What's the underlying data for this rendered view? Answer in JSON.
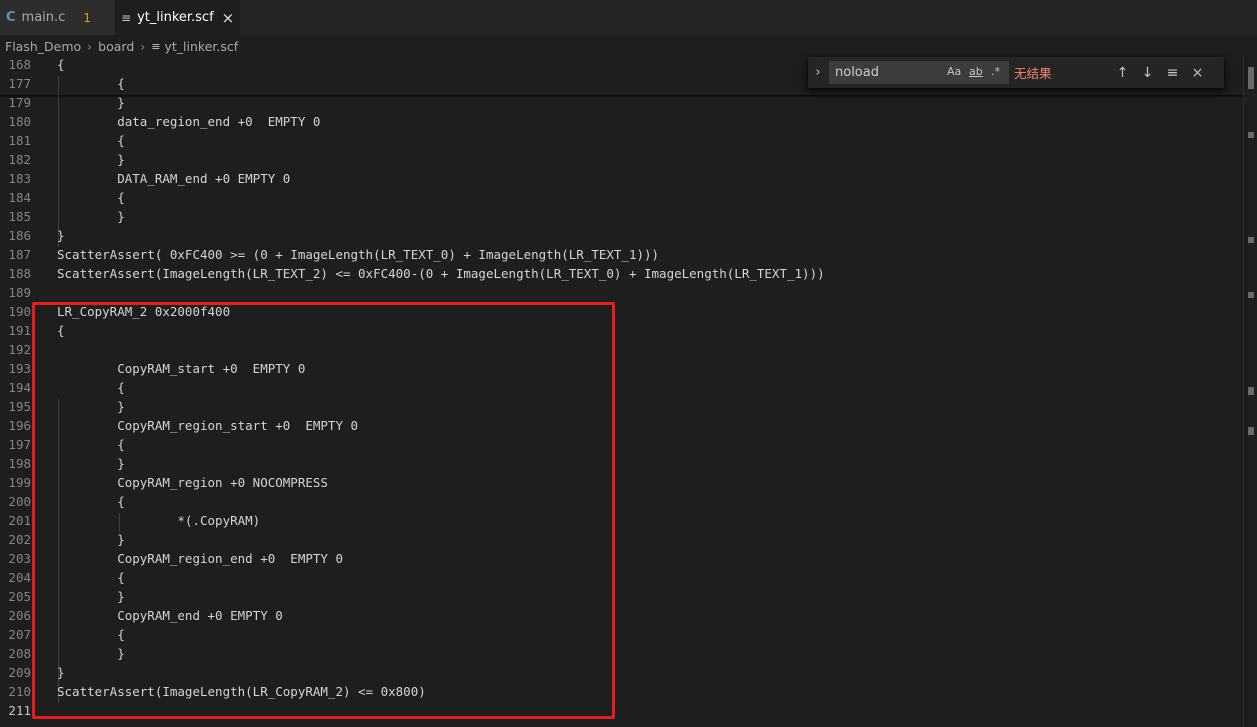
{
  "tabs": [
    {
      "icon": "C",
      "label": "main.c",
      "badge": "1",
      "active": false
    },
    {
      "icon": "≡",
      "label": "yt_linker.scf",
      "close": "×",
      "active": true
    }
  ],
  "breadcrumb": {
    "items": [
      "Flash_Demo",
      "board",
      "yt_linker.scf"
    ],
    "separator": "›",
    "file_icon": "≡"
  },
  "find": {
    "toggle": "›",
    "query": "noload",
    "match_case": "Aa",
    "whole_word": "ab",
    "regex": ".*",
    "result": "无结果",
    "prev": "↑",
    "next": "↓",
    "selection": "≡",
    "close": "×"
  },
  "lines": [
    {
      "n": "168",
      "text": "{"
    },
    {
      "n": "177",
      "text": "        {"
    },
    {
      "n": "179",
      "text": "        }"
    },
    {
      "n": "180",
      "text": "        data_region_end +0  EMPTY 0"
    },
    {
      "n": "181",
      "text": "        {"
    },
    {
      "n": "182",
      "text": "        }"
    },
    {
      "n": "183",
      "text": "        DATA_RAM_end +0 EMPTY 0"
    },
    {
      "n": "184",
      "text": "        {"
    },
    {
      "n": "185",
      "text": "        }"
    },
    {
      "n": "186",
      "text": "}"
    },
    {
      "n": "187",
      "text": "ScatterAssert( 0xFC400 >= (0 + ImageLength(LR_TEXT_0) + ImageLength(LR_TEXT_1)))"
    },
    {
      "n": "188",
      "text": "ScatterAssert(ImageLength(LR_TEXT_2) <= 0xFC400-(0 + ImageLength(LR_TEXT_0) + ImageLength(LR_TEXT_1)))"
    },
    {
      "n": "189",
      "text": ""
    },
    {
      "n": "190",
      "text": "LR_CopyRAM_2 0x2000f400"
    },
    {
      "n": "191",
      "text": "{"
    },
    {
      "n": "192",
      "text": ""
    },
    {
      "n": "193",
      "text": "        CopyRAM_start +0  EMPTY 0"
    },
    {
      "n": "194",
      "text": "        {"
    },
    {
      "n": "195",
      "text": "        }"
    },
    {
      "n": "196",
      "text": "        CopyRAM_region_start +0  EMPTY 0"
    },
    {
      "n": "197",
      "text": "        {"
    },
    {
      "n": "198",
      "text": "        }"
    },
    {
      "n": "199",
      "text": "        CopyRAM_region +0 NOCOMPRESS"
    },
    {
      "n": "200",
      "text": "        {"
    },
    {
      "n": "201",
      "text": "                *(.CopyRAM)"
    },
    {
      "n": "202",
      "text": "        }"
    },
    {
      "n": "203",
      "text": "        CopyRAM_region_end +0  EMPTY 0"
    },
    {
      "n": "204",
      "text": "        {"
    },
    {
      "n": "205",
      "text": "        }"
    },
    {
      "n": "206",
      "text": "        CopyRAM_end +0 EMPTY 0"
    },
    {
      "n": "207",
      "text": "        {"
    },
    {
      "n": "208",
      "text": "        }"
    },
    {
      "n": "209",
      "text": "}"
    },
    {
      "n": "210",
      "text": "ScatterAssert(ImageLength(LR_CopyRAM_2) <= 0x800)"
    },
    {
      "n": "211",
      "text": ""
    }
  ],
  "colors": {
    "highlight": "#e81c1c",
    "no_results": "#f48771",
    "modified_badge": "#cca700",
    "c_icon": "#519aba"
  }
}
